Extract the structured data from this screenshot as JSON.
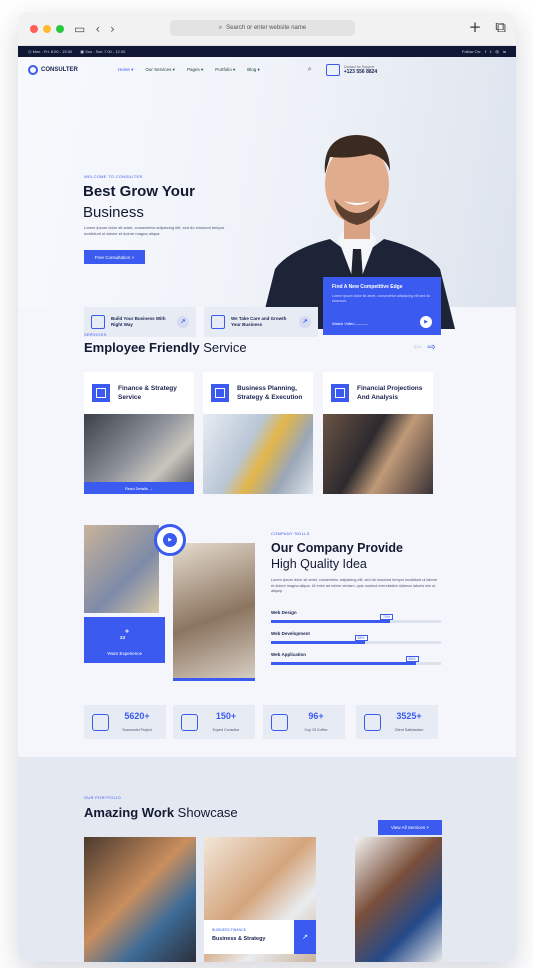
{
  "browser": {
    "address_placeholder": "Search or enter website name",
    "new_tab_icon": "+",
    "tabs_icon": "⧉"
  },
  "topbar": {
    "hours1": "Mon - Fri: 8.00 - 19.00",
    "hours2": "Sun - Sat: 7.00 - 12.00",
    "follow": "Follow On:"
  },
  "nav": {
    "logo": "CONSULTER",
    "items": [
      "Home ▾",
      "Our Services ▾",
      "Pages ▾",
      "Portfolio ▾",
      "Blog ▾"
    ],
    "support_label": "Contact for Support",
    "support_phone": "+123 556 8824"
  },
  "hero": {
    "kicker": "WELCOME TO CONSULTER",
    "title_bold": "Best Grow Your",
    "title_light": "Business",
    "text": "Lorem ipsum dolor sit amet, consectetur adipiscing elit, sed do eiusmod tempor incididunt ut labore et dolore magna aliqua.",
    "button": "Free Consultation  >",
    "card_title": "Find A New Competitive Edge",
    "card_text": "Lorem ipsum dolor sit amet, consectetur adipiscing elit sed do eiusmod.",
    "card_watch": "Watch Video  ———",
    "features": [
      "Build Your Business With Right Way",
      "We Take Care and Growth Your Business"
    ]
  },
  "services": {
    "kicker": "SERVICES",
    "title_bold": "Employee  Friendly",
    "title_light": " Service",
    "items": [
      {
        "name": "Finance & Strategy Service"
      },
      {
        "name": "Business Planning, Strategy & Execution"
      },
      {
        "name": "Financial Projections And Analysis"
      }
    ],
    "read_more": "Read Details  →"
  },
  "skills": {
    "kicker": "COMPANY SKILLS",
    "title_bold": "Our Company Provide",
    "title_light": "High Quality Idea",
    "text": "Lorem ipsum dolor sit amet, consectetur adipiscing elit, sed do eiusmod tempor incididunt ut labore et dolore magna aliqua. Ut enim ad minim veniam, quis nostrud exercitation ullamco laboris nisi ut aliquip.",
    "experience_number": "23",
    "experience_sup": "+",
    "experience_label": "Years Experience",
    "bars": [
      {
        "label": "Web Design",
        "percent": 70,
        "percent_text": "70%"
      },
      {
        "label": "Web Development",
        "percent": 55,
        "percent_text": "55%"
      },
      {
        "label": "Web Application",
        "percent": 85,
        "percent_text": "85%"
      }
    ]
  },
  "stats": [
    {
      "value": "5620+",
      "label": "Successful Project"
    },
    {
      "value": "150+",
      "label": "Expert Consultor"
    },
    {
      "value": "96+",
      "label": "Cup Of Coffee"
    },
    {
      "value": "3525+",
      "label": "Client Satisfaction"
    }
  ],
  "portfolio": {
    "kicker": "OUR PORTFOLIO",
    "title_bold": "Amazing Work",
    "title_light": " Showcase",
    "button": "View All Services  >",
    "caption_kicker": "BUSINESS FINANCE",
    "caption_title": "Business & Strategy"
  },
  "colors": {
    "accent": "#3b5bf0",
    "dark": "#101734"
  }
}
